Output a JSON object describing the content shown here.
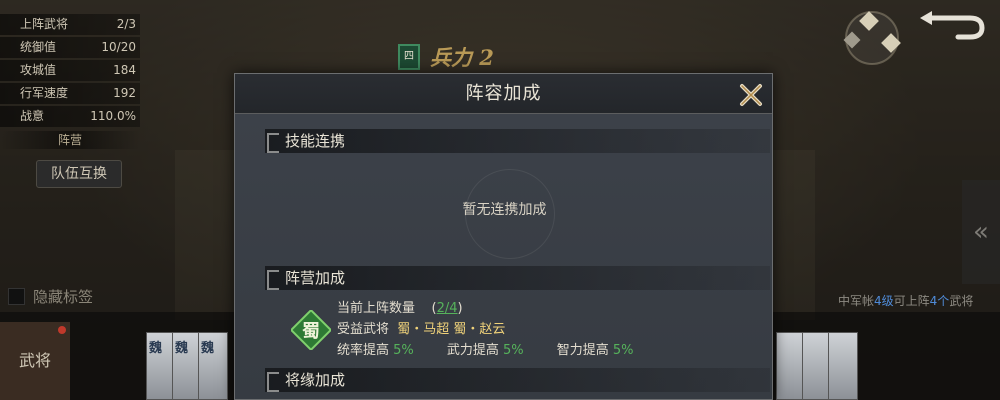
{
  "stats": [
    {
      "label": "上阵武将",
      "value": "2/3"
    },
    {
      "label": "统御值",
      "value": "10/20"
    },
    {
      "label": "攻城值",
      "value": "184"
    },
    {
      "label": "行军速度",
      "value": "192"
    },
    {
      "label": "战意",
      "value": "110.0%"
    }
  ],
  "camp_label": "阵营",
  "swap_button": "队伍互换",
  "hide_tags": "隐藏标签",
  "troop": {
    "badge": "四",
    "text": "兵力 2"
  },
  "right_arrow": "«",
  "center_info": {
    "prefix": "中军帐",
    "level": "4级",
    "mid": "可上阵",
    "count": "4个",
    "suffix": "武将"
  },
  "generals_tab": "武将",
  "cards": [
    "魏",
    "魏",
    "魏"
  ],
  "dialog": {
    "title": "阵容加成",
    "skill_section": "技能连携",
    "skill_empty": "暂无连携加成",
    "camp_section": "阵营加成",
    "camp_icon_char": "蜀",
    "current_label": "当前上阵数量",
    "current_value": "2/4",
    "beneficiary_label": "受益武将",
    "beneficiaries": "蜀・马超  蜀・赵云",
    "bonuses": [
      {
        "label": "统率提高",
        "value": "5%"
      },
      {
        "label": "武力提高",
        "value": "5%"
      },
      {
        "label": "智力提高",
        "value": "5%"
      }
    ],
    "fate_section": "将缘加成"
  },
  "colors": {
    "accent_green": "#56b35b",
    "accent_gold": "#f0d27a",
    "accent_blue": "#4f8bd8"
  }
}
